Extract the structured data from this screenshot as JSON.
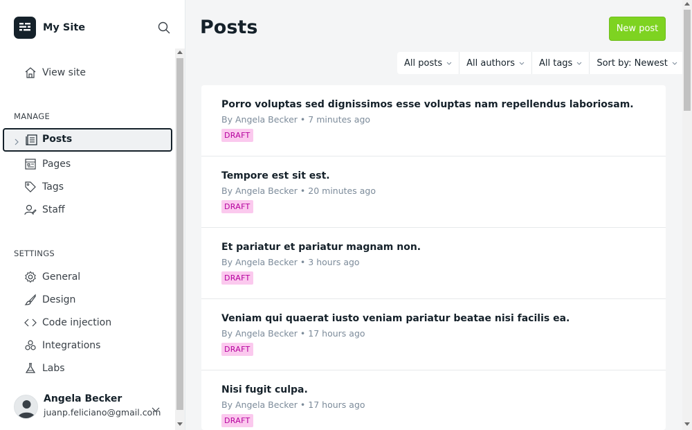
{
  "app": {
    "site_name": "My Site"
  },
  "sidebar": {
    "view_site_label": "View site",
    "manage_label": "MANAGE",
    "manage_items": [
      {
        "label": "Posts",
        "icon": "posts-icon",
        "active": true
      },
      {
        "label": "Pages",
        "icon": "pages-icon"
      },
      {
        "label": "Tags",
        "icon": "tag-icon"
      },
      {
        "label": "Staff",
        "icon": "staff-icon"
      }
    ],
    "settings_label": "SETTINGS",
    "settings_items": [
      {
        "label": "General",
        "icon": "gear-icon"
      },
      {
        "label": "Design",
        "icon": "brush-icon"
      },
      {
        "label": "Code injection",
        "icon": "code-icon"
      },
      {
        "label": "Integrations",
        "icon": "integrations-icon"
      },
      {
        "label": "Labs",
        "icon": "flask-icon"
      }
    ]
  },
  "user": {
    "name": "Angela Becker",
    "email": "juanp.feliciano@gmail.com"
  },
  "main": {
    "title": "Posts",
    "new_post_label": "New post",
    "filters": [
      "All posts",
      "All authors",
      "All tags",
      "Sort by: Newest"
    ],
    "posts": [
      {
        "title": "Porro voluptas sed dignissimos esse voluptas nam repellendus laboriosam.",
        "author": "Angela Becker",
        "time": "7 minutes ago",
        "status": "DRAFT"
      },
      {
        "title": "Tempore est sit est.",
        "author": "Angela Becker",
        "time": "20 minutes ago",
        "status": "DRAFT"
      },
      {
        "title": "Et pariatur et pariatur magnam non.",
        "author": "Angela Becker",
        "time": "3 hours ago",
        "status": "DRAFT"
      },
      {
        "title": "Veniam qui quaerat iusto veniam pariatur beatae nisi facilis ea.",
        "author": "Angela Becker",
        "time": "17 hours ago",
        "status": "DRAFT"
      },
      {
        "title": "Nisi fugit culpa.",
        "author": "Angela Becker",
        "time": "17 hours ago",
        "status": "DRAFT"
      }
    ],
    "meta_by": "By",
    "meta_sep": "•"
  },
  "colors": {
    "accent": "#7ed321",
    "draft_bg": "#fbc9ee",
    "draft_text": "#b5009d",
    "dark": "#15212a"
  }
}
